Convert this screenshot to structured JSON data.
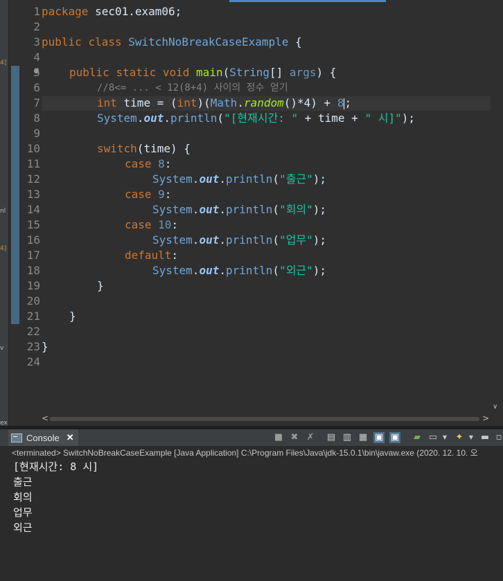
{
  "left_strip": {
    "marks": [
      "4]",
      "nl",
      "4]",
      "v",
      "ex"
    ]
  },
  "editor": {
    "line_numbers": [
      "1",
      "2",
      "3",
      "4",
      "5",
      "6",
      "7",
      "8",
      "9",
      "10",
      "11",
      "12",
      "13",
      "14",
      "15",
      "16",
      "17",
      "18",
      "19",
      "20",
      "21",
      "22",
      "23",
      "24"
    ],
    "code": {
      "l1_a": "package",
      "l1_b": " sec01.exam06;",
      "l3_a": "public",
      "l3_b": " ",
      "l3_c": "class",
      "l3_d": " ",
      "l3_e": "SwitchNoBreakCaseExample",
      "l3_f": " {",
      "l5_a": "public",
      "l5_b": "static",
      "l5_c": "void",
      "l5_d": "main",
      "l5_e": "(",
      "l5_f": "String",
      "l5_g": "[] ",
      "l5_h": "args",
      "l5_i": ") {",
      "l6": "//8<= ... < 12(8+4) 사이의 정수 얻기",
      "l7_a": "int",
      "l7_b": " time",
      "l7_c": " = (",
      "l7_d": "int",
      "l7_e": ")(",
      "l7_f": "Math",
      "l7_g": ".",
      "l7_h": "random",
      "l7_i": "()*4) + ",
      "l7_j": "8",
      "l7_k": ";",
      "l8_a": "System",
      "l8_b": ".",
      "l8_c": "out",
      "l8_d": ".",
      "l8_e": "println",
      "l8_f": "(",
      "l8_g": "\"[현재시간: \"",
      "l8_h": " + ",
      "l8_i": "time",
      "l8_j": " + ",
      "l8_k": "\" 시]\"",
      "l8_l": ");",
      "l10_a": "switch",
      "l10_b": "(",
      "l10_c": "time",
      "l10_d": ") {",
      "l11_a": "case",
      "l11_b": " 8",
      "l11_c": ":",
      "l12_str": "\"출근\"",
      "l13_a": "case",
      "l13_b": " 9",
      "l13_c": ":",
      "l14_str": "\"회의\"",
      "l15_a": "case",
      "l15_b": " 10",
      "l15_c": ":",
      "l16_str": "\"업무\"",
      "l17_a": "default",
      "l17_b": ":",
      "l18_str": "\"외근\"",
      "sys": "System",
      "dot": ".",
      "out": "out",
      "println": "println",
      "lp": "(",
      "rp": ");",
      "close_brace": "}"
    }
  },
  "console": {
    "tab_label": "Console",
    "status": "<terminated> SwitchNoBreakCaseExample [Java Application] C:\\Program Files\\Java\\jdk-15.0.1\\bin\\javaw.exe  (2020. 12. 10. 오",
    "output": [
      "[현재시간: 8 시]",
      "출근",
      "회의",
      "업무",
      "외근"
    ]
  }
}
